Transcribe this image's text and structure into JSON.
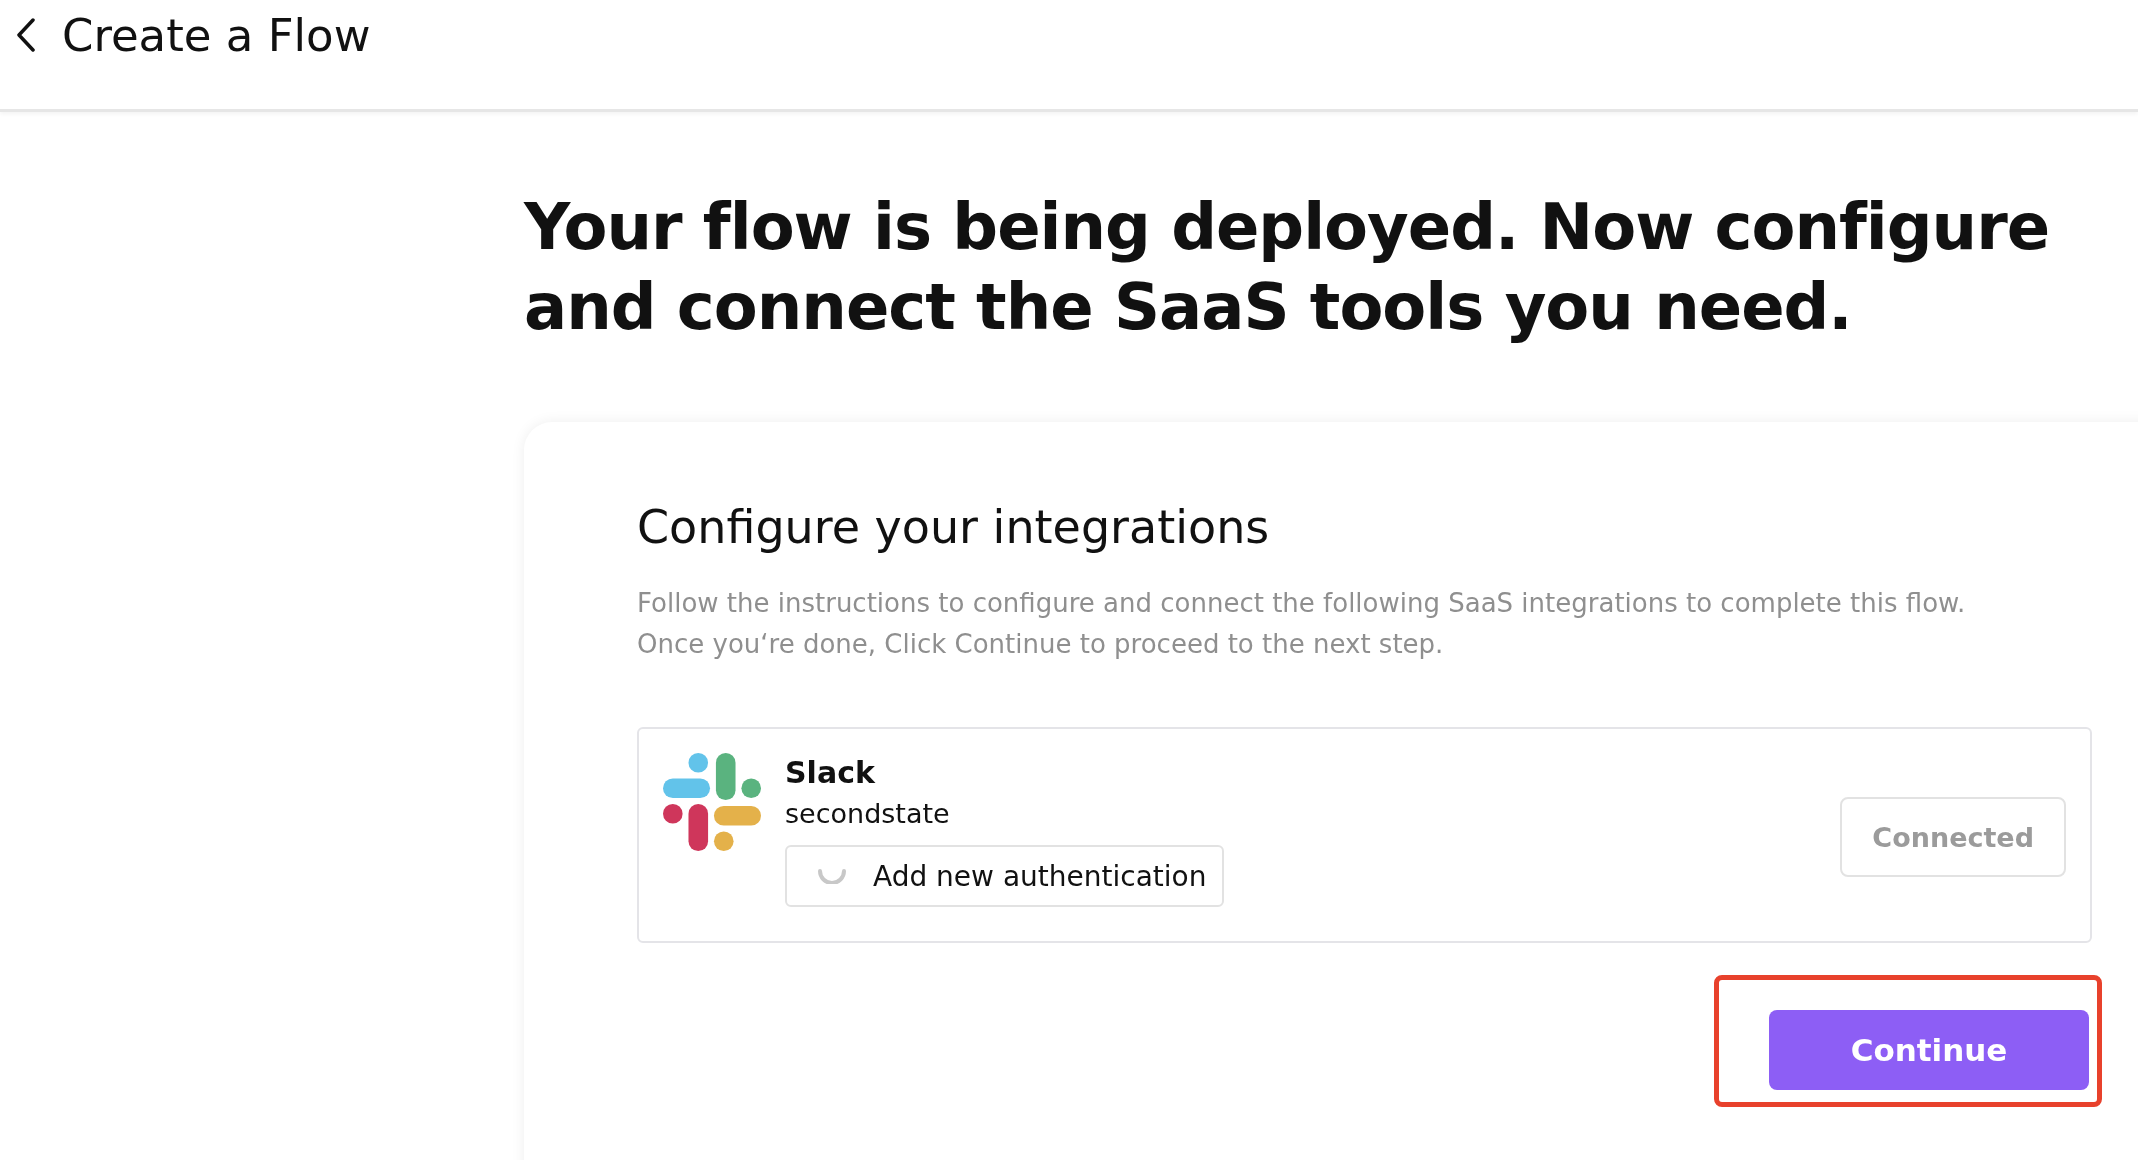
{
  "header": {
    "title": "Create a Flow"
  },
  "headline_lines": [
    "Your flow is being deployed. Now configure",
    "and connect the SaaS tools you need."
  ],
  "card": {
    "title": "Configure your integrations",
    "description_lines": [
      "Follow the instructions to configure and connect the following SaaS integrations to complete this flow.",
      "Once you‘re done, Click Continue to proceed to the next step."
    ],
    "integrations": [
      {
        "name": "Slack",
        "account": "secondstate",
        "auth_button": {
          "label": "Add new authentication",
          "loading": true
        },
        "status_button": {
          "label": "Connected",
          "disabled": true
        }
      }
    ],
    "continue_button": {
      "label": "Continue",
      "highlighted": true
    }
  }
}
